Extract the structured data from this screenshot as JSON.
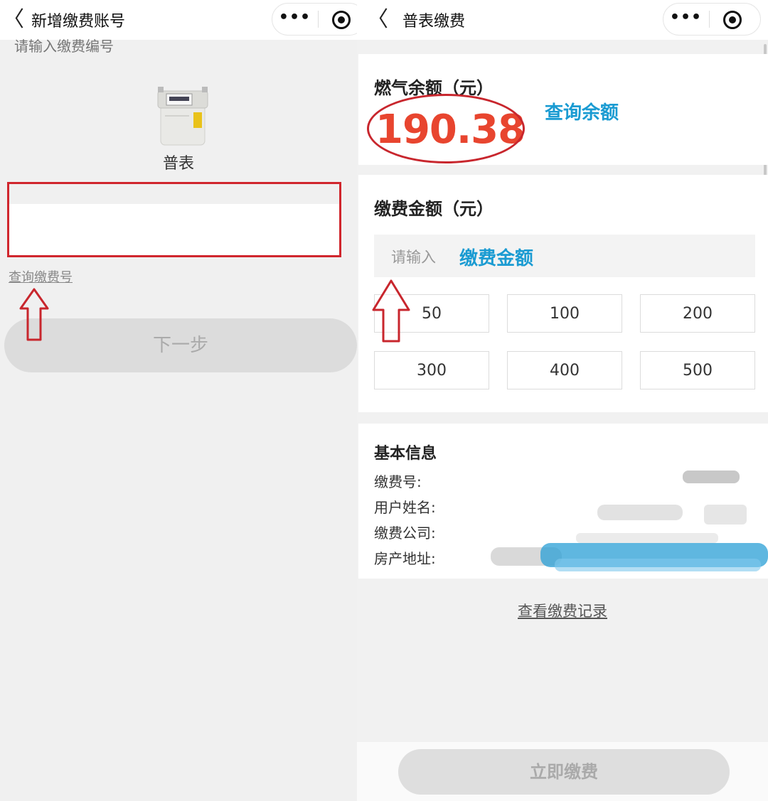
{
  "left": {
    "nav": {
      "back_glyph": "〈",
      "title": "新增缴费账号",
      "more_glyph": "•••"
    },
    "meter_label": "普表",
    "account_input": {
      "placeholder": "请输入缴费编号",
      "value": ""
    },
    "query_link": "查询缴费号",
    "next_button": "下一步"
  },
  "right": {
    "nav": {
      "back_glyph": "〈",
      "title": "普表缴费",
      "more_glyph": "•••"
    },
    "balance": {
      "title": "燃气余额（元）",
      "value": "190.38",
      "query_label": "查询余额"
    },
    "payment": {
      "title": "缴费金额（元）",
      "input_placeholder": "请输入",
      "input_label": "缴费金额",
      "amounts": [
        "50",
        "100",
        "200",
        "300",
        "400",
        "500"
      ]
    },
    "info": {
      "title": "基本信息",
      "rows": [
        "缴费号:",
        "用户姓名:",
        "缴费公司:",
        "房产地址:"
      ]
    },
    "records_link": "查看缴费记录",
    "pay_button": "立即缴费"
  },
  "colors": {
    "accent_red": "#e8452f",
    "annotation_red": "#d0262d",
    "link_blue": "#1a9bd2"
  },
  "icons": [
    "back-icon",
    "more-icon",
    "record-icon",
    "gas-meter-icon",
    "arrow-up-icon"
  ]
}
